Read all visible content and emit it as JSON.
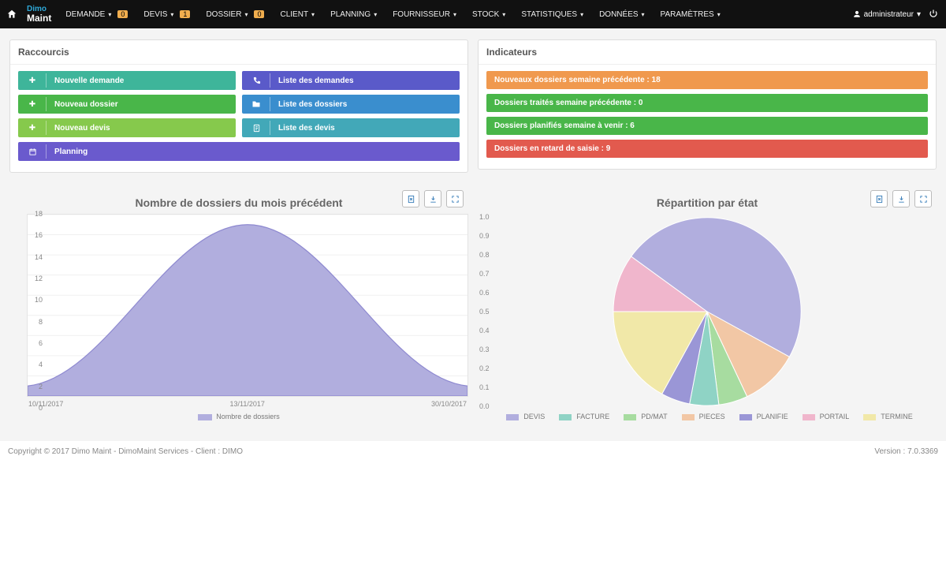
{
  "nav": {
    "items": [
      {
        "label": "DEMANDE",
        "badge": "0"
      },
      {
        "label": "DEVIS",
        "badge": "1"
      },
      {
        "label": "DOSSIER",
        "badge": "0"
      },
      {
        "label": "CLIENT"
      },
      {
        "label": "PLANNING"
      },
      {
        "label": "FOURNISSEUR"
      },
      {
        "label": "STOCK"
      },
      {
        "label": "STATISTIQUES"
      },
      {
        "label": "DONNÉES"
      },
      {
        "label": "PARAMÈTRES"
      }
    ],
    "user": "administrateur",
    "logo_top": "Dimo",
    "logo_bot": "Maint"
  },
  "panels": {
    "shortcuts_title": "Raccourcis",
    "indicators_title": "Indicateurs"
  },
  "shortcuts": {
    "new_request": "Nouvelle demande",
    "list_requests": "Liste des demandes",
    "new_folder": "Nouveau dossier",
    "list_folders": "Liste des dossiers",
    "new_quote": "Nouveau devis",
    "list_quotes": "Liste des devis",
    "planning": "Planning"
  },
  "indicators": {
    "new_prev": "Nouveaux dossiers semaine précédente : 18",
    "treated_prev": "Dossiers traités semaine précédente : 0",
    "planned_next": "Dossiers planifiés semaine à venir : 6",
    "late": "Dossiers en retard de saisie : 9"
  },
  "footer": {
    "left": "Copyright © 2017 Dimo Maint - DimoMaint Services - Client : DIMO",
    "right": "Version : 7.0.3369"
  },
  "chart_data": [
    {
      "type": "area",
      "title": "Nombre de dossiers du mois précédent",
      "x": [
        "10/11/2017",
        "13/11/2017",
        "30/10/2017"
      ],
      "values": [
        1,
        17,
        1
      ],
      "ylim": [
        0,
        18
      ],
      "yticks": [
        0,
        2,
        4,
        6,
        8,
        10,
        12,
        14,
        16,
        18
      ],
      "legend": "Nombre de dossiers"
    },
    {
      "type": "pie",
      "title": "Répartition par état",
      "yticks": [
        0,
        0.1,
        0.2,
        0.3,
        0.4,
        0.5,
        0.6,
        0.7,
        0.8,
        0.9,
        1.0
      ],
      "series": [
        {
          "name": "DEVIS",
          "value": 0.48,
          "color": "#b1aede"
        },
        {
          "name": "FACTURE",
          "value": 0.05,
          "color": "#8fd3c5"
        },
        {
          "name": "PD/MAT",
          "value": 0.05,
          "color": "#a7dca0"
        },
        {
          "name": "PIECES",
          "value": 0.1,
          "color": "#f2c7a5"
        },
        {
          "name": "PLANIFIE",
          "value": 0.05,
          "color": "#9a96d6"
        },
        {
          "name": "PORTAIL",
          "value": 0.1,
          "color": "#f0b6cc"
        },
        {
          "name": "TERMINE",
          "value": 0.17,
          "color": "#f1e8a8"
        }
      ]
    }
  ]
}
